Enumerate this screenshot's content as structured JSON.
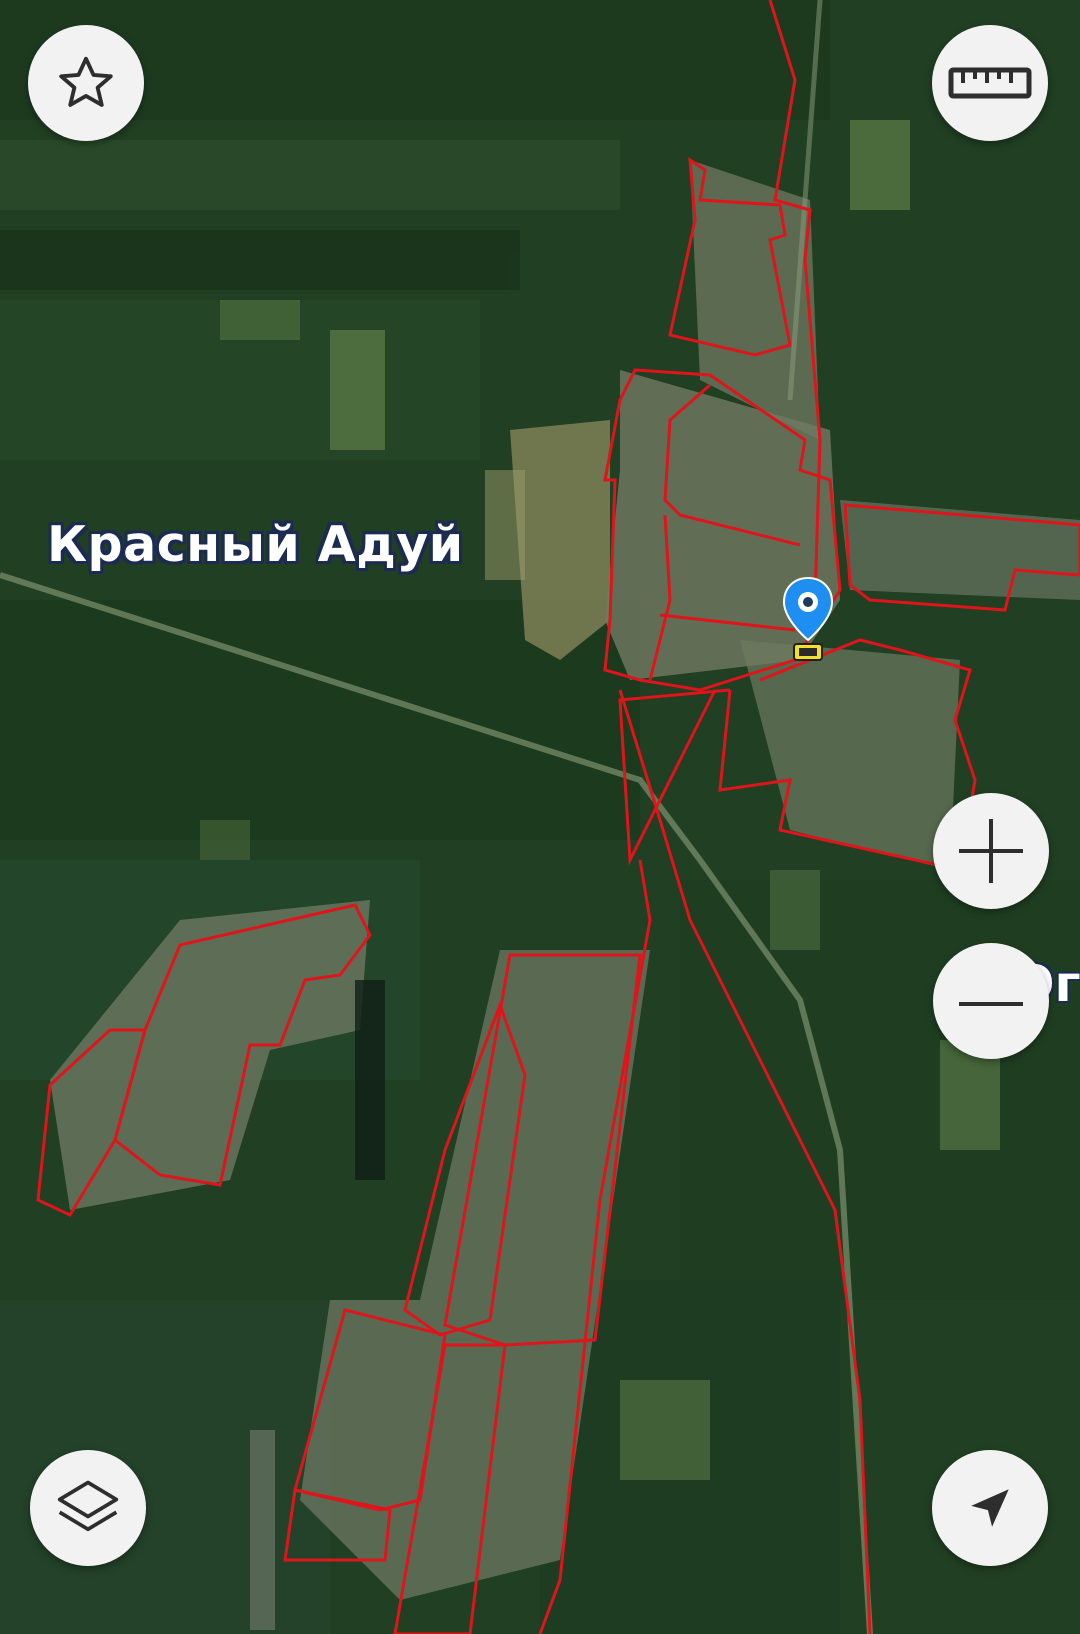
{
  "map": {
    "type": "satellite",
    "place_labels": {
      "main": "Красный Адуй",
      "edge": "Ог"
    },
    "overlay_color": "#e0141b",
    "marker_color": "#1f8ef1",
    "marker_accent": "#f4e02a"
  },
  "controls": {
    "favorites": {
      "icon": "star-icon"
    },
    "ruler": {
      "icon": "ruler-icon"
    },
    "zoom_in": {
      "icon": "plus-icon"
    },
    "zoom_out": {
      "icon": "minus-icon"
    },
    "layers": {
      "icon": "layers-icon"
    },
    "locate": {
      "icon": "navigation-arrow-icon"
    }
  }
}
